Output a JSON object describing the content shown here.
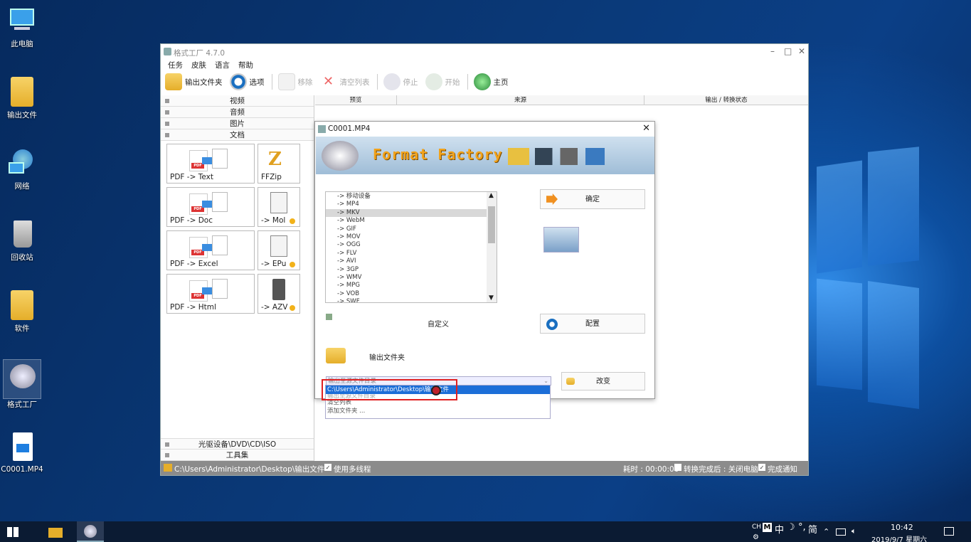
{
  "desktop": {
    "icons": [
      {
        "label": "此电脑",
        "icon": "computer-icon"
      },
      {
        "label": "输出文件",
        "icon": "folder-icon"
      },
      {
        "label": "网络",
        "icon": "network-icon"
      },
      {
        "label": "回收站",
        "icon": "recycle-bin-icon"
      },
      {
        "label": "软件",
        "icon": "folder-icon"
      },
      {
        "label": "格式工厂",
        "icon": "format-factory-icon"
      },
      {
        "label": "C0001.MP4",
        "icon": "video-file-icon"
      }
    ]
  },
  "app": {
    "title": "格式工厂 4.7.0",
    "menu": [
      "任务",
      "皮肤",
      "语言",
      "帮助"
    ],
    "toolbar": {
      "output_folder": "输出文件夹",
      "options": "选项",
      "remove": "移除",
      "clear_list": "清空列表",
      "stop": "停止",
      "start": "开始",
      "home": "主页"
    },
    "categories": {
      "video": "视频",
      "audio": "音频",
      "image": "图片",
      "document": "文档",
      "optical": "光驱设备\\DVD\\CD\\ISO",
      "tools": "工具集"
    },
    "tiles": {
      "pdf_text": "PDF -> Text",
      "ffzip": "FFZip",
      "pdf_doc": "PDF -> Doc",
      "mobi": "-> Mol",
      "pdf_excel": "PDF -> Excel",
      "epub": "-> EPu",
      "pdf_html": "PDF -> Html",
      "azw": "-> AZV"
    },
    "columns": {
      "preview": "预览",
      "source": "来源",
      "output": "输出 / 转换状态"
    },
    "status": {
      "path": "C:\\Users\\Administrator\\Desktop\\输出文件",
      "multithread": "使用多线程",
      "elapsed": "耗时 : 00:00:00",
      "after": "转换完成后 : 关闭电脑",
      "notify": "完成通知"
    }
  },
  "dialog": {
    "title": "C0001.MP4",
    "banner": "Format Factory",
    "formats": [
      "-> 移动设备",
      "-> MP4",
      "-> MKV",
      "-> WebM",
      "-> GIF",
      "-> MOV",
      "-> OGG",
      "-> FLV",
      "-> AVI",
      "-> 3GP",
      "-> WMV",
      "-> MPG",
      "-> VOB",
      "-> SWF"
    ],
    "ok": "确定",
    "custom": "自定义",
    "config": "配置",
    "output_folder": "输出文件夹",
    "dropdown_value": "输出至源文件目录",
    "change": "改变",
    "dropdown_options": [
      "C:\\Users\\Administrator\\Desktop\\输出文件",
      "输出至源文件目录",
      "清空列表",
      "添加文件夹 ..."
    ]
  },
  "taskbar": {
    "ime": "CH",
    "ime2": "中",
    "ime3": "简",
    "time": "10:42",
    "date": "2019/9/7 星期六"
  }
}
